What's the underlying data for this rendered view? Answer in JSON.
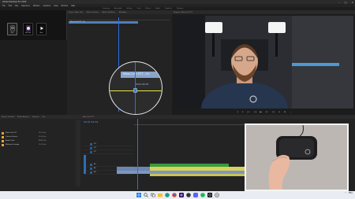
{
  "window": {
    "title": "Adobe Premiere Pro 2022",
    "menu": [
      "File",
      "Edit",
      "Clip",
      "Sequence",
      "Markers",
      "Graphics",
      "View",
      "Window",
      "Help"
    ],
    "controls": [
      "–",
      "□",
      "×"
    ]
  },
  "workspaces": [
    "Learning",
    "Assembly",
    "Editing",
    "Color",
    "Effects",
    "Audio",
    "Graphics",
    "Libraries"
  ],
  "stream_deck": {
    "keys": [
      {
        "label": "Test",
        "icon": "elgato-icon"
      },
      {
        "label": "Inst Sele",
        "icon": "record-icon"
      },
      {
        "label": "Next",
        "icon": "play-icon"
      }
    ]
  },
  "source_panel": {
    "tabs": [
      "Source: Mass Link",
      "Effect Controls",
      "Audio Clip Mixer",
      "Metadata"
    ],
    "clip_label": "Mass Link 077 - Sn"
  },
  "magnifier": {
    "clip_label": "Mass Link 077 - Sn",
    "timecode": "00:01:40:19"
  },
  "program_panel": {
    "tabs": [
      "Program: Mass Link 077"
    ],
    "transport": [
      "{",
      "}",
      "|<",
      "<|",
      "▶",
      "|>",
      ">|",
      "⇥",
      "⊕",
      "⋯"
    ]
  },
  "project_panel": {
    "tabs": [
      "Project: Untitled",
      "Media Browser",
      "Libraries",
      "Info"
    ],
    "items": [
      {
        "name": "Mass Link 077",
        "rate": "25.00 fps"
      },
      {
        "name": "Camera Source",
        "rate": "25.00 fps"
      },
      {
        "name": "Audio Track",
        "rate": "48000 Hz"
      },
      {
        "name": "Webcam Footage",
        "rate": "25.00 fps"
      }
    ]
  },
  "timeline_panel": {
    "tabs": [
      "Mass Link 077"
    ],
    "timecode": "00:01:40:19",
    "tracks": [
      "V3",
      "V2",
      "V1",
      "A1",
      "A2",
      "A3"
    ]
  },
  "colors": {
    "accent": "#2f6ee0",
    "clip_video": "#8aa5cc",
    "clip_audio": "#3c9a3c",
    "clip_yellow": "#d8d25a",
    "stripe": "#e6e64a"
  },
  "taskbar": {
    "icons": [
      "windows-start-icon",
      "search-icon",
      "task-view-icon",
      "file-explorer-icon",
      "edge-icon",
      "chrome-icon",
      "premiere-icon",
      "obs-icon",
      "discord-icon",
      "spotify-icon",
      "stream-deck-icon",
      "settings-icon"
    ],
    "tray": [
      "^",
      "ENG"
    ]
  }
}
